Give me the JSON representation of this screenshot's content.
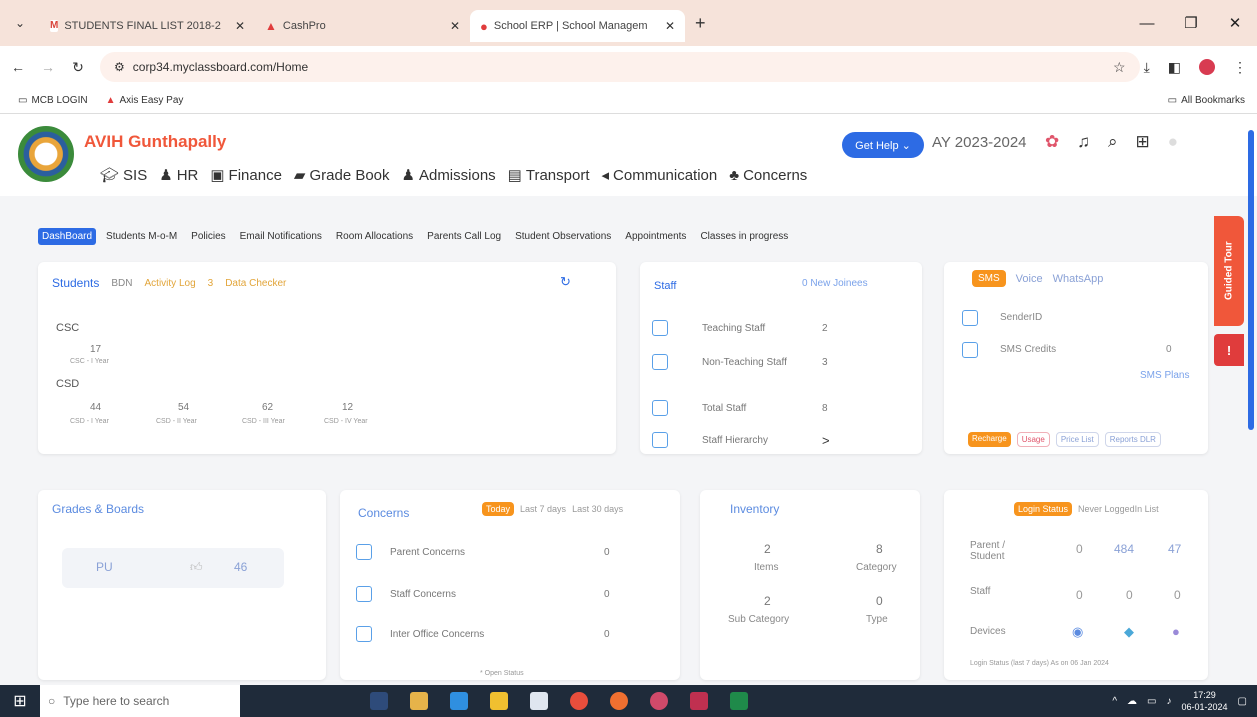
{
  "browser": {
    "tabs": [
      {
        "title": "STUDENTS FINAL LIST 2018-2",
        "fav_color": "#d9443a",
        "fav_text": "M"
      },
      {
        "title": "CashPro",
        "fav_color": "#e03c3c",
        "fav_text": "▲"
      },
      {
        "title": "School ERP | School Managem",
        "fav_color": "#e03c3c",
        "fav_text": "●"
      }
    ],
    "url": "corp34.myclassboard.com/Home",
    "bookmarks": [
      "MCB LOGIN",
      "Axis Easy Pay"
    ],
    "all_bookmarks": "All Bookmarks"
  },
  "app": {
    "school_name": "AVIH Gunthapally",
    "modules": [
      "SIS",
      "HR",
      "Finance",
      "Grade Book",
      "Admissions",
      "Transport",
      "Communication",
      "Concerns"
    ],
    "get_help": "Get Help ⌄",
    "academic_year": "AY 2023-2024"
  },
  "subtabs": [
    "DashBoard",
    "Students M-o-M",
    "Policies",
    "Email Notifications",
    "Room Allocations",
    "Parents Call Log",
    "Student Observations",
    "Appointments",
    "Classes in progress"
  ],
  "students": {
    "title": "Students",
    "links": [
      "BDN",
      "Activity Log",
      "3",
      "Data Checker"
    ],
    "groups": [
      {
        "name": "CSC",
        "items": [
          {
            "value": "17",
            "label": "CSC - I Year"
          }
        ]
      },
      {
        "name": "CSD",
        "items": [
          {
            "value": "44",
            "label": "CSD - I Year"
          },
          {
            "value": "54",
            "label": "CSD - II Year"
          },
          {
            "value": "62",
            "label": "CSD - III Year"
          },
          {
            "value": "12",
            "label": "CSD - IV Year"
          }
        ]
      }
    ]
  },
  "staff": {
    "title": "Staff",
    "new_joinees": "0 New Joinees",
    "rows": [
      {
        "label": "Teaching Staff",
        "value": "2"
      },
      {
        "label": "Non-Teaching Staff",
        "value": "3"
      },
      {
        "label": "Total Staff",
        "value": "8"
      },
      {
        "label": "Staff Hierarchy",
        "value": ">"
      }
    ]
  },
  "sms": {
    "tabs": [
      "SMS",
      "Voice",
      "WhatsApp"
    ],
    "sender_label": "SenderID",
    "credits_label": "SMS Credits",
    "credits_value": "0",
    "plans": "SMS Plans",
    "buttons": [
      "Recharge",
      "Usage",
      "Price List",
      "Reports DLR"
    ]
  },
  "guided_tour": "Guided Tour",
  "grades": {
    "title": "Grades & Boards",
    "board": "PU",
    "count": "46"
  },
  "concerns": {
    "title": "Concerns",
    "filters": [
      "Today",
      "Last 7 days",
      "Last 30 days"
    ],
    "rows": [
      {
        "label": "Parent Concerns",
        "value": "0"
      },
      {
        "label": "Staff Concerns",
        "value": "0"
      },
      {
        "label": "Inter Office Concerns",
        "value": "0"
      }
    ],
    "footer": "* Open Status"
  },
  "inventory": {
    "title": "Inventory",
    "cells": [
      {
        "value": "2",
        "label": "Items"
      },
      {
        "value": "8",
        "label": "Category"
      },
      {
        "value": "2",
        "label": "Sub Category"
      },
      {
        "value": "0",
        "label": "Type"
      }
    ]
  },
  "login_status": {
    "tabs": [
      "Login Status",
      "Never LoggedIn List"
    ],
    "rows": [
      {
        "label": "Parent / Student",
        "values": [
          "0",
          "484",
          "47"
        ]
      },
      {
        "label": "Staff",
        "values": [
          "0",
          "0",
          "0"
        ]
      },
      {
        "label": "Devices",
        "values": [
          "",
          "",
          ""
        ]
      }
    ],
    "footer": "Login Status (last 7 days) As on 06 Jan 2024"
  },
  "taskbar": {
    "search_placeholder": "Type here to search",
    "time": "17:29",
    "date": "06-01-2024"
  }
}
